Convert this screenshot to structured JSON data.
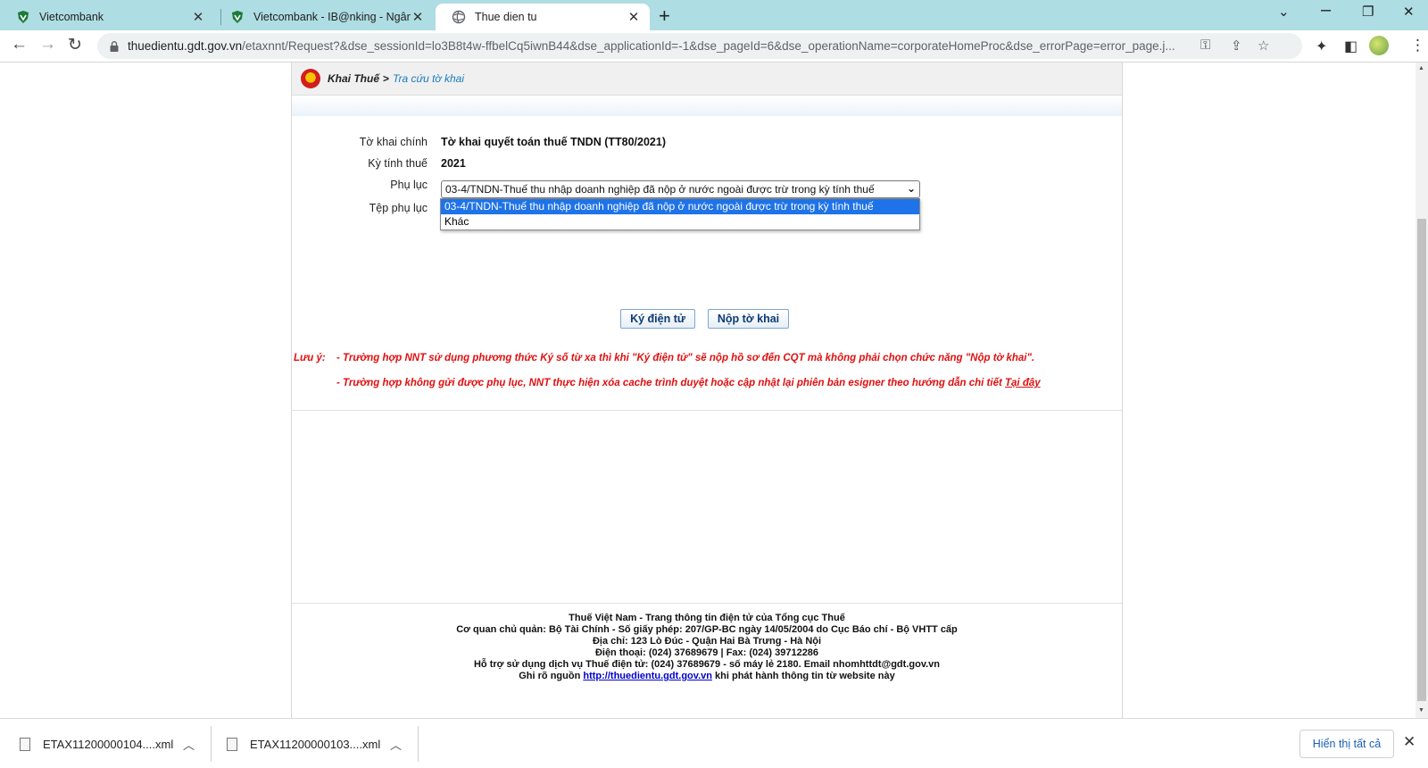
{
  "browser": {
    "tabs": [
      {
        "title": "Vietcombank",
        "active": false
      },
      {
        "title": "Vietcombank - IB@nking - Ngân",
        "active": false
      },
      {
        "title": "Thue dien tu",
        "active": true
      }
    ],
    "new_tab_symbol": "+",
    "window_controls": {
      "minimize": "⌄",
      "restore": "❐",
      "close": "✕"
    },
    "address": {
      "host": "thuedientu.gdt.gov.vn",
      "path": "/etaxnnt/Request?&dse_sessionId=lo3B8t4w-ffbelCq5iwnB44&dse_applicationId=-1&dse_pageId=6&dse_operationName=corporateHomeProc&dse_errorPage=error_page.j..."
    },
    "icons": [
      "back-arrow-icon",
      "forward-arrow-icon",
      "reload-icon",
      "lock-icon",
      "key-icon",
      "share-icon",
      "star-icon",
      "extensions-icon",
      "sidepanel-icon",
      "profile-avatar",
      "menu-kebab-icon"
    ]
  },
  "breadcrumb": {
    "root": "Khai Thuế",
    "separator": ">",
    "current": "Tra cứu tờ khai"
  },
  "form": {
    "main_label": "Tờ khai chính",
    "main_value": "Tờ khai quyết toán thuế TNDN (TT80/2021)",
    "period_label": "Kỳ tính thuế",
    "period_value": "2021",
    "appendix_label": "Phụ lục",
    "appendix_selected": "03-4/TNDN-Thuế thu nhập doanh nghiệp đã nộp ở nước ngoài được trừ trong kỳ tính thuế",
    "appendix_options": [
      "03-4/TNDN-Thuế thu nhập doanh nghiệp đã nộp ở nước ngoài được trừ trong kỳ tính thuế",
      "Khác"
    ],
    "appendix_file_label": "Tệp phụ lục",
    "sign_button": "Ký điện tử",
    "submit_button": "Nộp tờ khai"
  },
  "notes": {
    "prefix": "Lưu ý:",
    "line1": "- Trường hợp NNT sử dụng phương thức Ký số từ xa thì khi \"Ký điện tử\" sẽ nộp hồ sơ đến CQT mà không phải chọn chức năng \"Nộp tờ khai\".",
    "line2": "- Trường hợp không gửi được phụ lục, NNT thực hiện xóa cache trình duyệt hoặc cập nhật lại phiên bản esigner theo hướng dẫn chi tiết",
    "link": "Tại đây"
  },
  "footer": {
    "line1": "Thuế Việt Nam - Trang thông tin điện tử của Tổng cục Thuế",
    "line2": "Cơ quan chủ quản: Bộ Tài Chính - Số giấy phép: 207/GP-BC ngày 14/05/2004 do Cục Báo chí - Bộ VHTT cấp",
    "line3": "Địa chỉ: 123 Lò Đúc - Quận Hai Bà Trưng - Hà Nội",
    "line4": "Điện thoại: (024) 37689679 | Fax: (024) 39712286",
    "line5": "Hỗ trợ sử dụng dịch vụ Thuế điện tử: (024) 37689679 - số máy lẻ 2180. Email nhomhttdt@gdt.gov.vn",
    "line6_prefix": "Ghi rõ nguồn",
    "line6_link": "http://thuedientu.gdt.gov.vn",
    "line6_suffix": "khi phát hành thông tin từ website này"
  },
  "downloads": {
    "items": [
      "ETAX11200000104....xml",
      "ETAX11200000103....xml"
    ],
    "show_all": "Hiển thị tất cả"
  },
  "colors": {
    "tabstrip": "#aedde3",
    "note_red": "#e01010",
    "crumb_link": "#1a7bbf",
    "selected_option": "#1e73e8"
  }
}
